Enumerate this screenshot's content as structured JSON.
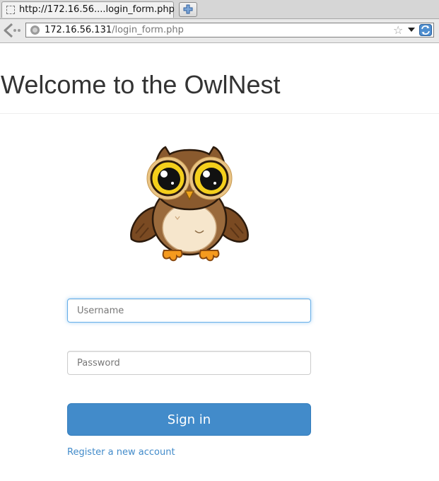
{
  "browser": {
    "tab_title": "http://172.16.56....login_form.php",
    "url_host": "172.16.56.131",
    "url_path": "/login_form.php"
  },
  "page": {
    "title": "Welcome to the OwlNest"
  },
  "login_form": {
    "username_placeholder": "Username",
    "password_placeholder": "Password",
    "signin_label": "Sign in",
    "register_label": "Register a new account"
  },
  "colors": {
    "primary": "#428bca",
    "title_text": "#333333",
    "focus_border": "#66afe9"
  }
}
